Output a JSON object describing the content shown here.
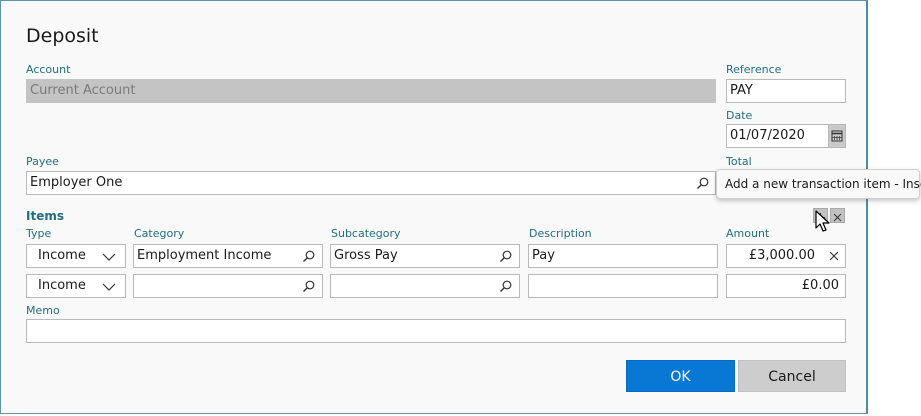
{
  "dialog": {
    "title": "Deposit"
  },
  "account": {
    "label": "Account",
    "value": "Current Account"
  },
  "reference": {
    "label": "Reference",
    "value": "PAY"
  },
  "date": {
    "label": "Date",
    "value": "01/07/2020"
  },
  "payee": {
    "label": "Payee",
    "value": "Employer One"
  },
  "total": {
    "label": "Total"
  },
  "tooltip": {
    "text": "Add a new transaction item - Insert"
  },
  "items": {
    "label": "Items",
    "columns": {
      "type": "Type",
      "category": "Category",
      "subcategory": "Subcategory",
      "description": "Description",
      "amount": "Amount"
    },
    "rows": [
      {
        "type": "Income",
        "category": "Employment Income",
        "subcategory": "Gross Pay",
        "description": "Pay",
        "amount": "£3,000.00"
      },
      {
        "type": "Income",
        "category": "",
        "subcategory": "",
        "description": "",
        "amount": "£0.00"
      }
    ]
  },
  "memo": {
    "label": "Memo",
    "value": ""
  },
  "buttons": {
    "ok": "OK",
    "cancel": "Cancel"
  },
  "colors": {
    "accent": "#0878d4",
    "label": "#1f6e82"
  },
  "icons": [
    "search-icon",
    "calendar-icon",
    "chevron-down-icon",
    "close-icon",
    "add-icon",
    "mouse-cursor-icon"
  ]
}
